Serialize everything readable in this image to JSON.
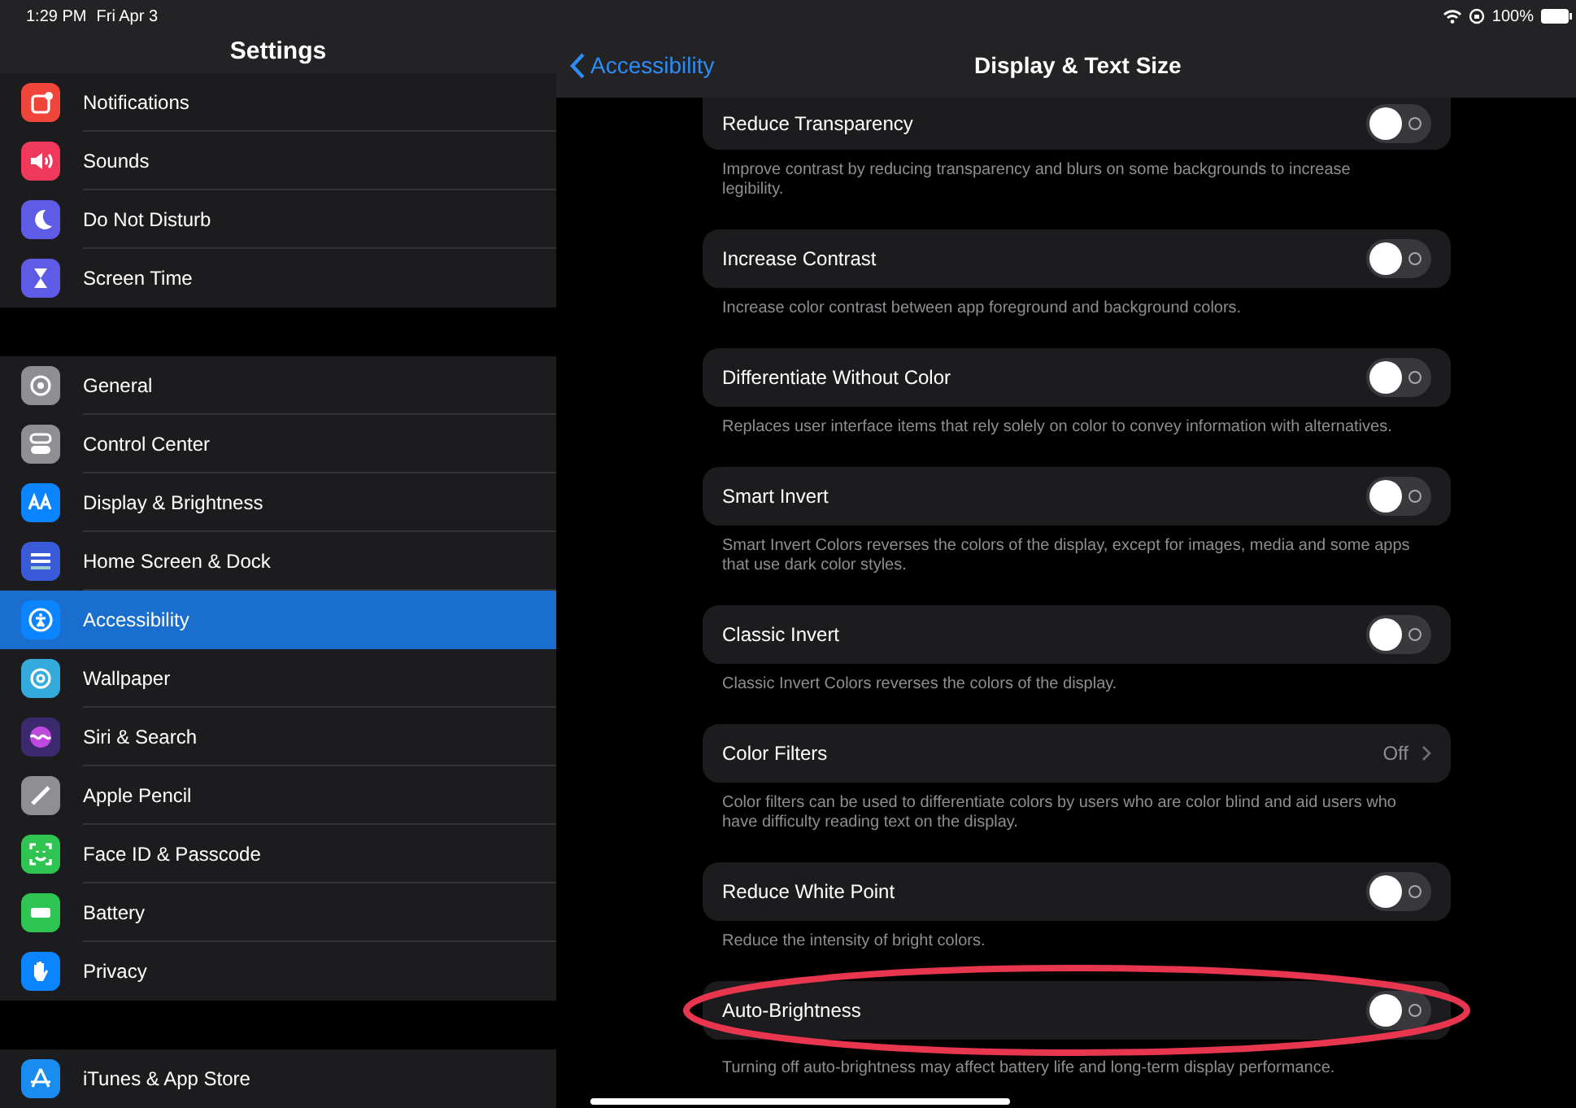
{
  "status_bar": {
    "time": "1:29 PM",
    "date": "Fri Apr 3",
    "battery": "100%"
  },
  "sidebar": {
    "title": "Settings",
    "sections": [
      [
        {
          "label": "Notifications",
          "color": "#f0453a",
          "selected": false
        },
        {
          "label": "Sounds",
          "color": "#f0385a",
          "selected": false
        },
        {
          "label": "Do Not Disturb",
          "color": "#5e5ce6",
          "selected": false
        },
        {
          "label": "Screen Time",
          "color": "#5e5ce6",
          "selected": false
        }
      ],
      [
        {
          "label": "General",
          "color": "#8e8e93",
          "selected": false
        },
        {
          "label": "Control Center",
          "color": "#8e8e93",
          "selected": false
        },
        {
          "label": "Display & Brightness",
          "color": "#0a84ff",
          "selected": false
        },
        {
          "label": "Home Screen & Dock",
          "color": "#3a5bd9",
          "selected": false
        },
        {
          "label": "Accessibility",
          "color": "#0a84ff",
          "selected": true
        },
        {
          "label": "Wallpaper",
          "color": "#35aadc",
          "selected": false
        },
        {
          "label": "Siri & Search",
          "color": "#3b2a6e",
          "selected": false
        },
        {
          "label": "Apple Pencil",
          "color": "#8e8e93",
          "selected": false
        },
        {
          "label": "Face ID & Passcode",
          "color": "#30c452",
          "selected": false
        },
        {
          "label": "Battery",
          "color": "#30c452",
          "selected": false
        },
        {
          "label": "Privacy",
          "color": "#0a84ff",
          "selected": false
        }
      ],
      [
        {
          "label": "iTunes & App Store",
          "color": "#1a8cf0",
          "selected": false
        }
      ]
    ]
  },
  "detail": {
    "back": "Accessibility",
    "title": "Display & Text Size",
    "settings": [
      {
        "kind": "toggle",
        "label": "Reduce Transparency",
        "on": false,
        "footer": "Improve contrast by reducing transparency and blurs on some backgrounds to increase legibility."
      },
      {
        "kind": "toggle",
        "label": "Increase Contrast",
        "on": false,
        "footer": "Increase color contrast between app foreground and background colors."
      },
      {
        "kind": "toggle",
        "label": "Differentiate Without Color",
        "on": false,
        "footer": "Replaces user interface items that rely solely on color to convey information with alternatives."
      },
      {
        "kind": "toggle",
        "label": "Smart Invert",
        "on": false,
        "footer": "Smart Invert Colors reverses the colors of the display, except for images, media and some apps that use dark color styles."
      },
      {
        "kind": "toggle",
        "label": "Classic Invert",
        "on": false,
        "footer": "Classic Invert Colors reverses the colors of the display."
      },
      {
        "kind": "disclosure",
        "label": "Color Filters",
        "value": "Off",
        "footer": "Color filters can be used to differentiate colors by users who are color blind and aid users who have difficulty reading text on the display."
      },
      {
        "kind": "toggle",
        "label": "Reduce White Point",
        "on": false,
        "footer": "Reduce the intensity of bright colors."
      },
      {
        "kind": "toggle",
        "label": "Auto-Brightness",
        "on": false,
        "highlighted": true,
        "footer": "Turning off auto-brightness may affect battery life and long-term display performance."
      }
    ]
  }
}
